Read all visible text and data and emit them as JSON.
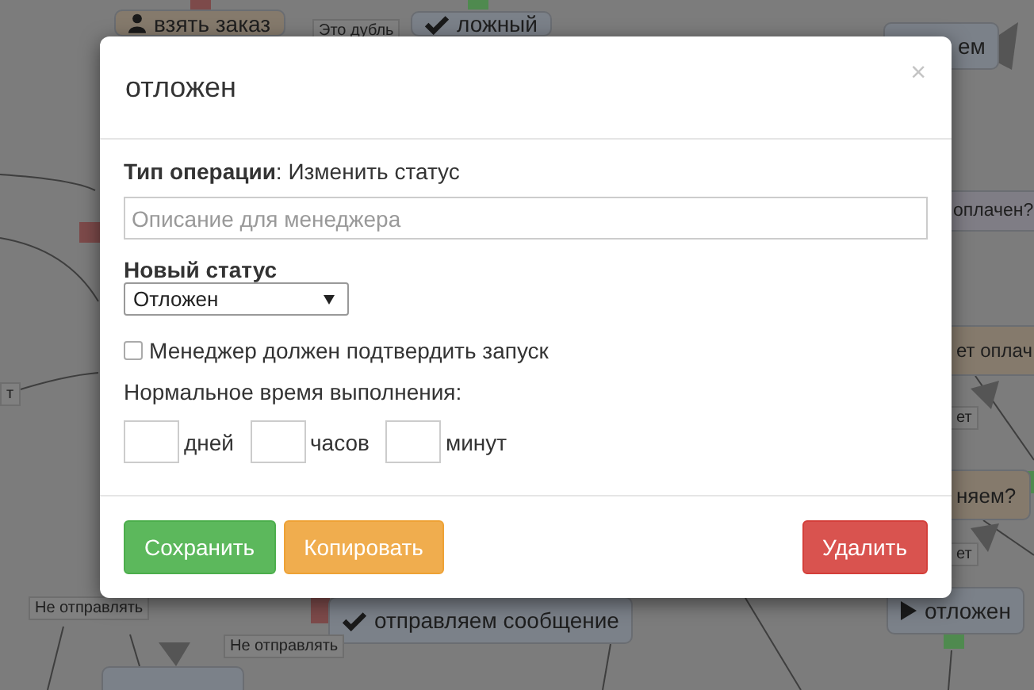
{
  "diagram": {
    "nodes": [
      {
        "kind": "person",
        "text": "взять заказ",
        "color": "#857a6c"
      },
      {
        "kind": "check",
        "text": "ложный",
        "color": "#7b8189"
      },
      {
        "kind": "plain",
        "text": "ем",
        "color": "#7b8189"
      },
      {
        "kind": "plain",
        "text": "оплачен?",
        "color": "#7f7d85"
      },
      {
        "kind": "plain",
        "text": "ет оплач",
        "color": "#857a6c"
      },
      {
        "kind": "plain",
        "text": "няем?",
        "color": "#857a6c"
      },
      {
        "kind": "play",
        "text": "отложен",
        "color": "#7b8189"
      },
      {
        "kind": "check",
        "text": "отправляем сообщение",
        "color": "#7b8189"
      }
    ],
    "labels": [
      "Это дубль",
      "т",
      "ет",
      "ет",
      "Не отправлять",
      "Не отправлять"
    ]
  },
  "modal": {
    "title": "отложен",
    "close": "×",
    "operation": "**Тип операции**: Изменить статус",
    "description": {
      "placeholder": "Описание для менеджера"
    },
    "status_label": "Новый статус",
    "status": {
      "value": "Отложен"
    },
    "confirm": {
      "label": "Менеджер должен подтвердить запуск",
      "checked": false
    },
    "duration_label": "Нормальное время выполнения:",
    "durations": [
      {
        "unit": "дней"
      },
      {
        "unit": "часов"
      },
      {
        "unit": "минут"
      }
    ],
    "buttons": [
      {
        "label": "Сохранить",
        "kind": "success"
      },
      {
        "label": "Копировать",
        "kind": "warning"
      },
      {
        "label": "Удалить",
        "kind": "danger"
      }
    ]
  }
}
